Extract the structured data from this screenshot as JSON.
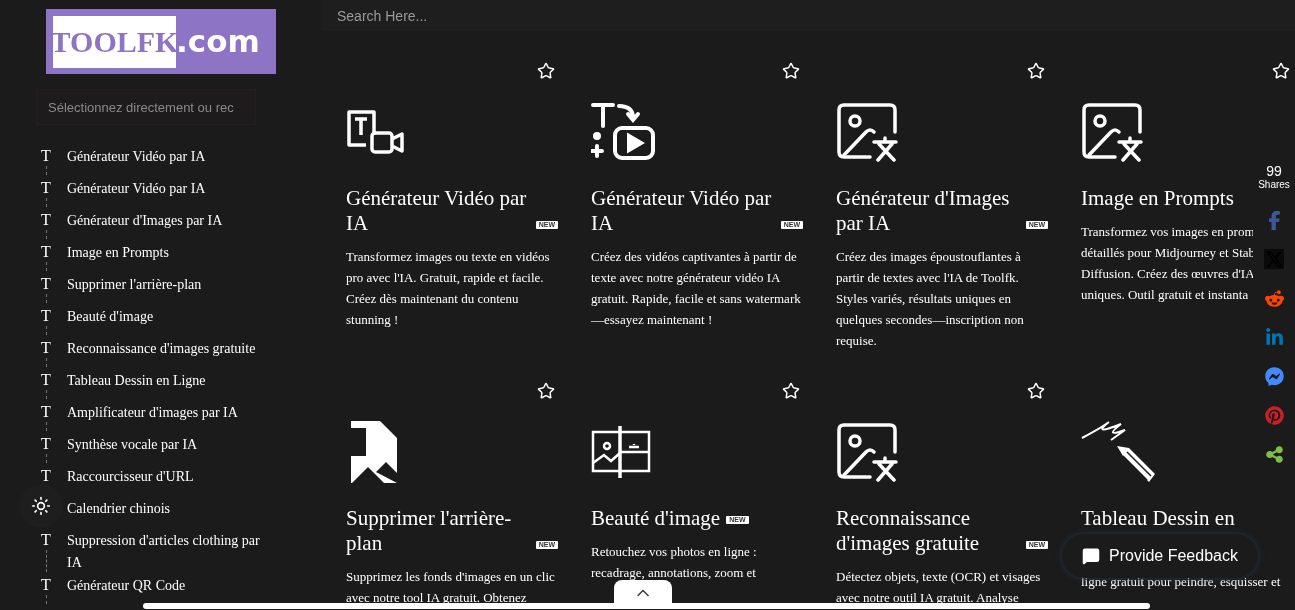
{
  "logo": {
    "name": "TOOLFK",
    "domain": ".com"
  },
  "sidebar": {
    "search": {
      "placeholder": "Sélectionnez directement ou rec"
    },
    "items": [
      {
        "icon": "T",
        "label": "Générateur Vidéo par IA"
      },
      {
        "icon": "T",
        "label": "Générateur Vidéo par IA"
      },
      {
        "icon": "T",
        "label": "Générateur d'Images par IA"
      },
      {
        "icon": "T",
        "label": "Image en Prompts"
      },
      {
        "icon": "T",
        "label": "Supprimer l'arrière-plan"
      },
      {
        "icon": "T",
        "label": "Beauté d'image"
      },
      {
        "icon": "T",
        "label": "Reconnaissance d'images gratuite"
      },
      {
        "icon": "T",
        "label": "Tableau Dessin en Ligne"
      },
      {
        "icon": "T",
        "label": "Amplificateur d'images par IA"
      },
      {
        "icon": "T",
        "label": "Synthèse vocale par IA"
      },
      {
        "icon": "T",
        "label": "Raccourcisseur d'URL"
      },
      {
        "label": "Calendrier chinois"
      },
      {
        "icon": "T",
        "label": "Suppression d'articles clothing par IA"
      },
      {
        "icon": "T",
        "label": "Générateur QR Code"
      }
    ]
  },
  "search": {
    "placeholder": "Search Here..."
  },
  "cards": [
    {
      "title": "Générateur Vidéo par IA",
      "badge": "NEW",
      "description": "Transformez images ou texte en vidéos pro avec l'IA. Gratuit, rapide et facile. Créez dès maintenant du contenu stunning !"
    },
    {
      "title": "Générateur Vidéo par IA",
      "badge": "NEW",
      "description": "Créez des vidéos captivantes à partir de texte avec notre générateur vidéo IA gratuit. Rapide, facile et sans watermark—essayez maintenant !"
    },
    {
      "title": "Générateur d'Images par IA",
      "badge": "NEW",
      "description": "Créez des images époustouflantes à partir de textes avec l'IA de Toolfk. Styles variés, résultats uniques en quelques secondes—inscription non requise."
    },
    {
      "title": "Image en Prompts",
      "description": "Transformez vos images en prom détaillés pour Midjourney et Stab Diffusion. Créez des œuvres d'IA uniques. Outil gratuit et instanta"
    },
    {
      "title": "Supprimer l'arrière-plan",
      "badge": "NEW",
      "description": "Supprimez les fonds d'images en un clic avec notre tool IA gratuit. Obtenez"
    },
    {
      "title": "Beauté d'image",
      "badge": "NEW",
      "description": "Retouchez vos photos en ligne : recadrage, annotations, zoom et"
    },
    {
      "title": "Reconnaissance d'images gratuite",
      "badge": "NEW",
      "description": "Détectez objets, texte (OCR) et visages avec notre outil IA gratuit. Analyse"
    },
    {
      "title": "Tableau Dessin en",
      "description": "ligne gratuit pour peindre, esquisser et"
    }
  ],
  "share": {
    "count": "99",
    "label": "Shares"
  },
  "feedback": {
    "label": "Provide Feedback"
  }
}
